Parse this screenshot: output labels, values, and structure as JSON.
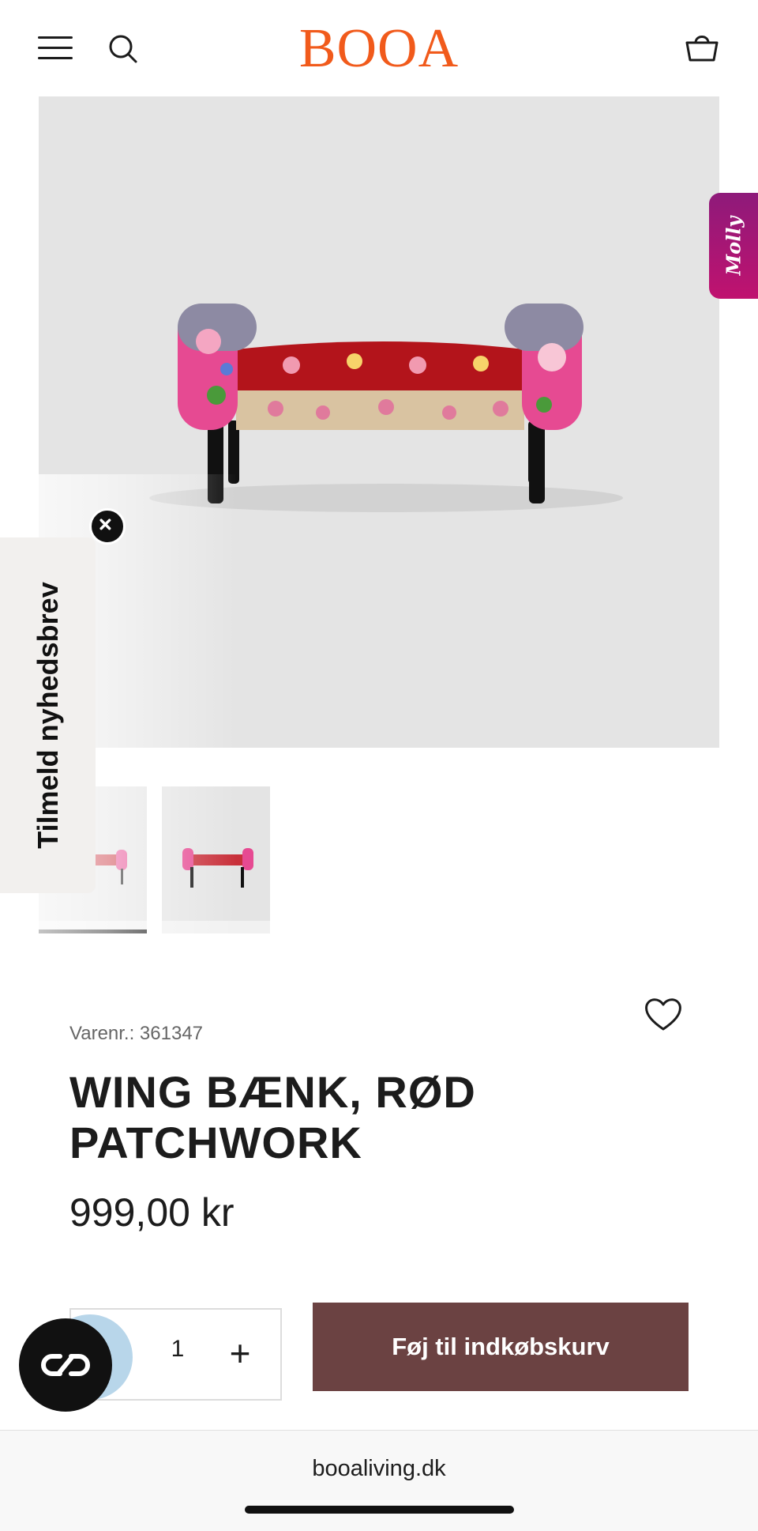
{
  "header": {
    "brand": "BOOA",
    "brand_color": "#f15a1b",
    "icons": [
      "hamburger-menu-icon",
      "search-icon",
      "shopping-basket-icon"
    ]
  },
  "gallery": {
    "thumbnail_count": 2,
    "active_thumbnail": 1
  },
  "molly_tab": {
    "label": "Molly"
  },
  "newsletter_tab": {
    "label": "Tilmeld nyhedsbrev"
  },
  "product": {
    "sku_label": "Varenr.: 361347",
    "title": "WING BÆNK, RØD PATCHWORK",
    "price": "999,00 kr",
    "quantity": "1",
    "plus_label": "+",
    "add_to_cart_label": "Føj til indkøbskurv",
    "button_color": "#6b4242"
  },
  "browser": {
    "url": "booaliving.dk"
  }
}
